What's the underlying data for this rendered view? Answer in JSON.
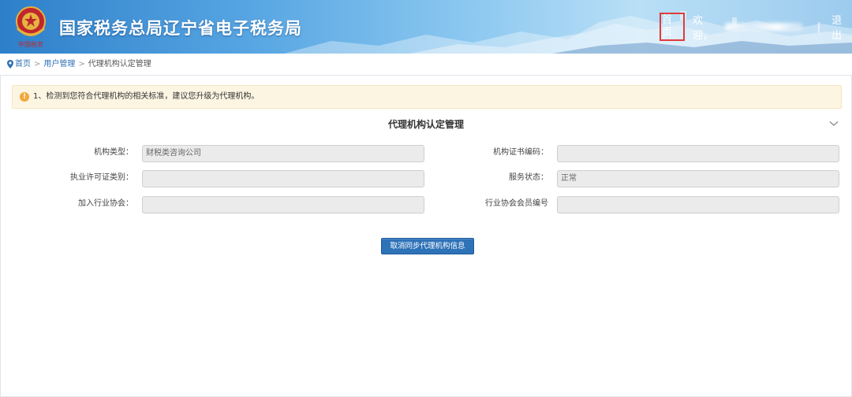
{
  "header": {
    "site_title": "国家税务总局辽宁省电子税务局",
    "emblem_text": "中国税务",
    "nav": {
      "home": "首页",
      "welcome": "欢迎，",
      "separator": "|",
      "logout": "退出"
    }
  },
  "breadcrumb": {
    "items": [
      "首页",
      "用户管理",
      "代理机构认定管理"
    ],
    "separator": ">"
  },
  "notice": {
    "icon": "!",
    "text": "1、检测到您符合代理机构的相关标准，建议您升级为代理机构。"
  },
  "section": {
    "title": "代理机构认定管理"
  },
  "form": {
    "fields": [
      {
        "label": "机构类型：",
        "value": ""
      },
      {
        "label": "机构证书编码：",
        "value": ""
      },
      {
        "label": "执业许可证类别：",
        "value": ""
      },
      {
        "label": "服务状态：",
        "value": "正常"
      },
      {
        "label": "加入行业协会：",
        "value": ""
      },
      {
        "label": "行业协会会员编号",
        "value": ""
      }
    ],
    "org_type_value": "财税类咨询公司"
  },
  "actions": {
    "cancel_sync_label": "取消同步代理机构信息"
  },
  "colors": {
    "primary": "#2e72b8",
    "header_start": "#2d7fc9",
    "notice_bg": "#fcf5e2",
    "warn": "#f3a73a"
  }
}
